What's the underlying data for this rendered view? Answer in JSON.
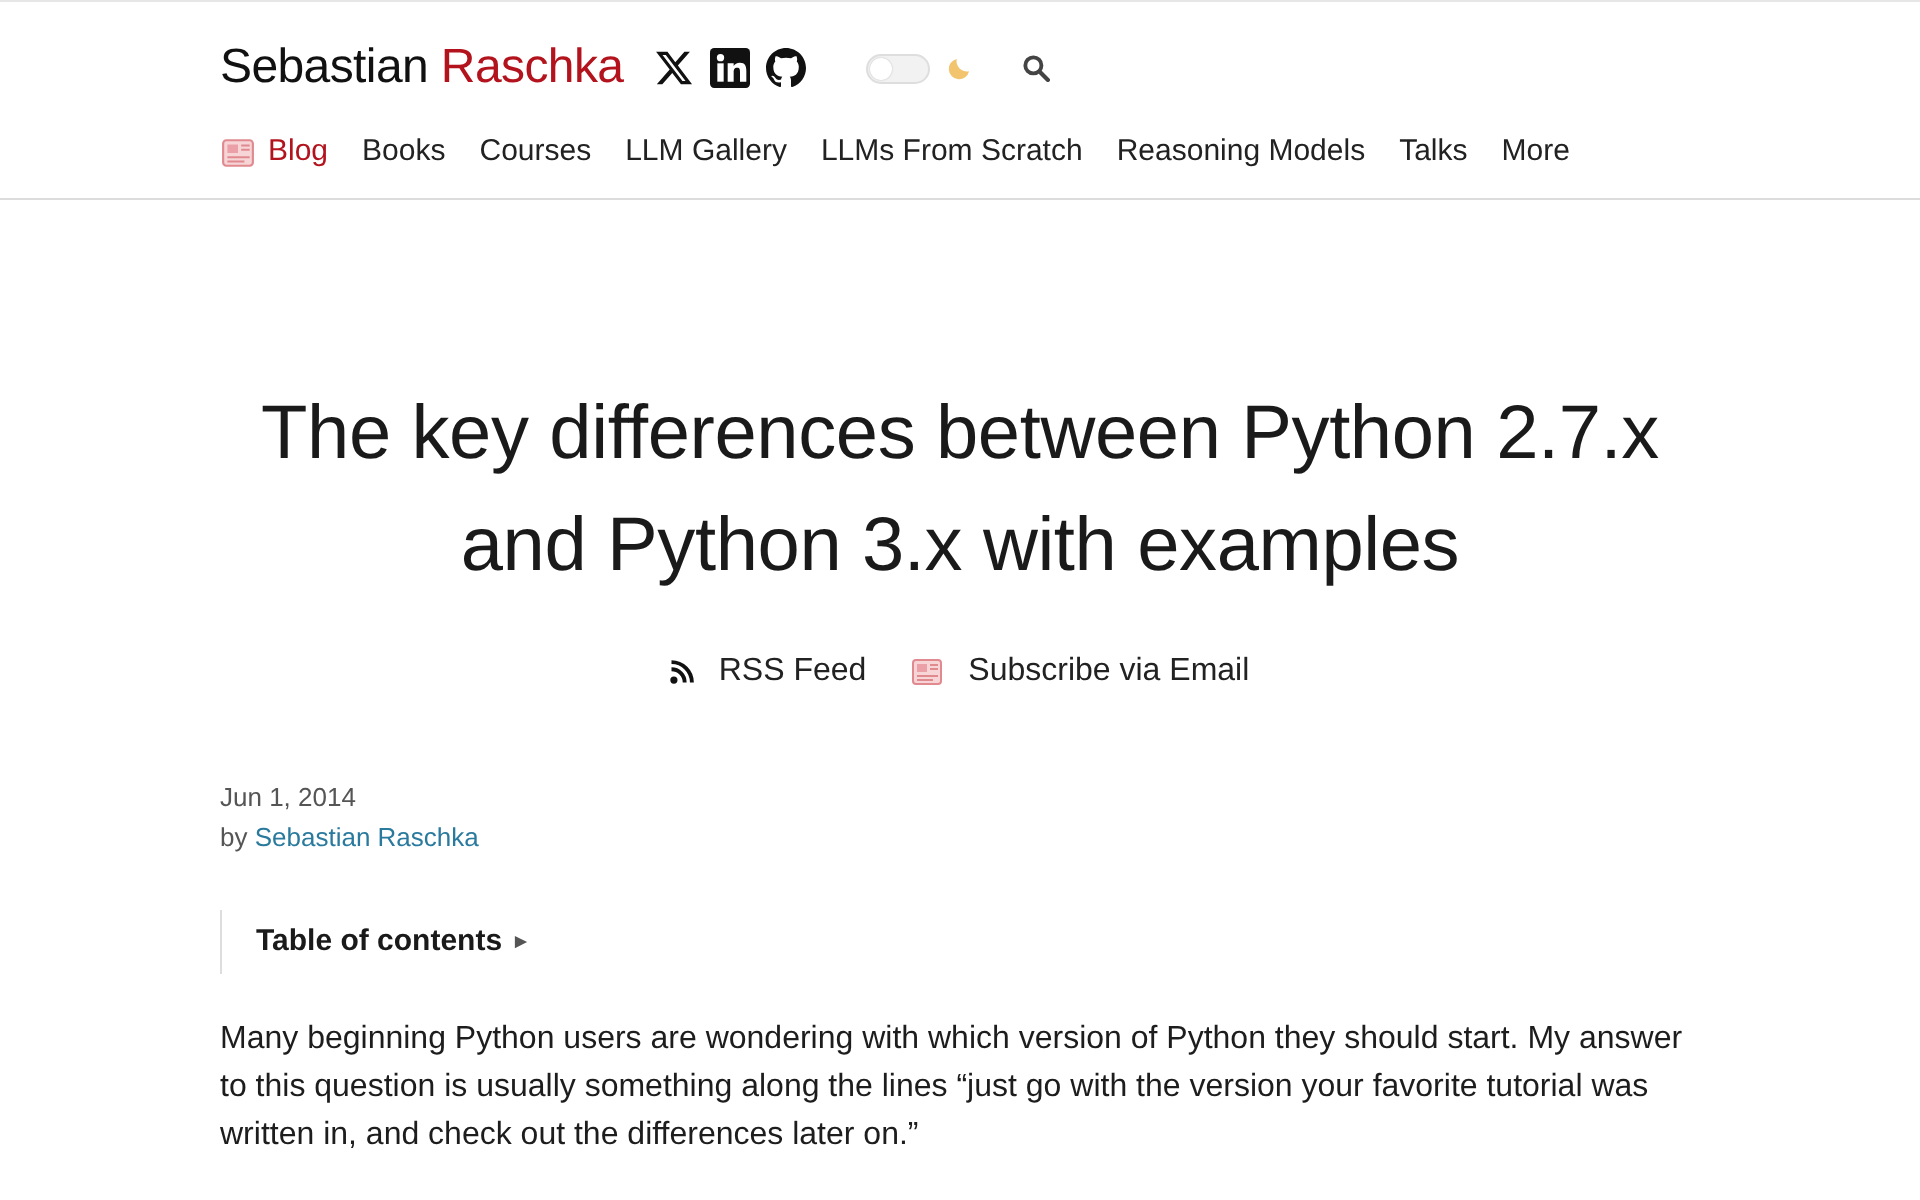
{
  "header": {
    "site_title": {
      "first": "Sebastian",
      "last": "Raschka"
    },
    "theme_toggle": {
      "on": false
    },
    "nav": [
      {
        "label": "Blog",
        "selected": true,
        "kind": "icon-link"
      },
      {
        "label": "Books",
        "selected": false,
        "kind": "link"
      },
      {
        "label": "Courses",
        "selected": false,
        "kind": "link"
      },
      {
        "label": "LLM Gallery",
        "selected": false,
        "kind": "link"
      },
      {
        "label": "LLMs From Scratch",
        "selected": false,
        "kind": "link"
      },
      {
        "label": "Reasoning Models",
        "selected": false,
        "kind": "link"
      },
      {
        "label": "Talks",
        "selected": false,
        "kind": "link"
      },
      {
        "label": "More",
        "selected": false,
        "kind": "link"
      }
    ]
  },
  "article": {
    "title": "The key differences between Python 2.7.x and Python 3.x with examples",
    "feeds": [
      {
        "label": "RSS Feed",
        "kind": "rss"
      },
      {
        "label": "Subscribe via Email",
        "kind": "email"
      }
    ],
    "date": "Jun 1, 2014",
    "byline": {
      "prefix": "by",
      "author": "Sebastian Raschka"
    },
    "toc": {
      "label": "Table of contents",
      "expanded": false
    },
    "paragraphs": [
      "Many beginning Python users are wondering with which version of Python they should start. My answer to this question is usually something along the lines “just go with the version your favorite tutorial was written in, and check out the differences later on.”"
    ]
  }
}
